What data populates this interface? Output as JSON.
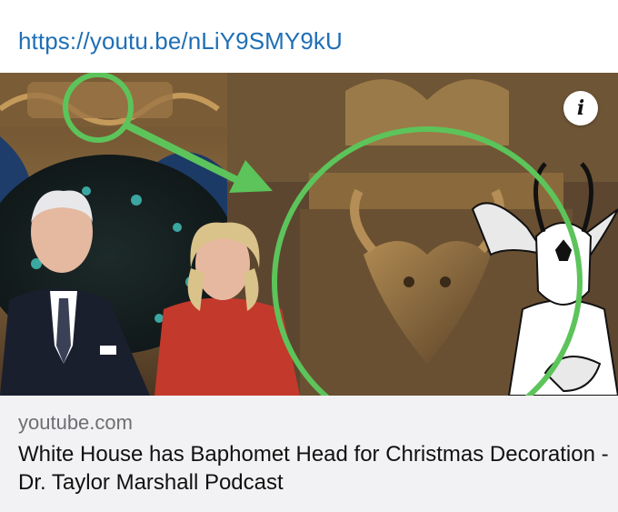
{
  "link": {
    "url_text": "https://youtu.be/nLiY9SMY9kU"
  },
  "preview": {
    "info_icon": "info-icon",
    "info_glyph": "i",
    "domain": "youtube.com",
    "title": "White House has Baphomet Head for Christmas Decoration - Dr. Taylor Marshall Podcast"
  },
  "colors": {
    "link": "#1f6fb5",
    "annotation_green": "#5cc45a",
    "card_background": "#f2f2f4"
  }
}
